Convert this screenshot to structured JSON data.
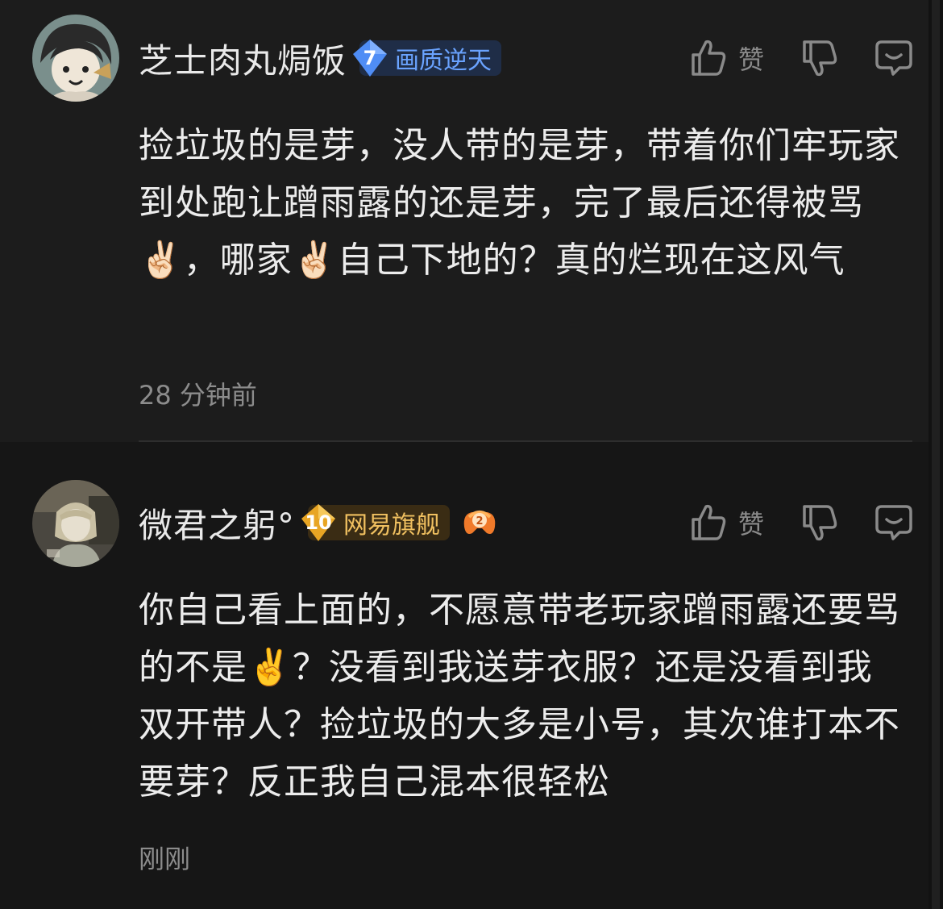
{
  "comments": [
    {
      "username": "芝士肉丸焗饭",
      "badge_level": "7",
      "badge_text": "画质逆天",
      "like_label": "赞",
      "text": "捡垃圾的是芽，没人带的是芽，带着你们牢玩家到处跑让蹭雨露的还是芽，完了最后还得被骂✌🏻，哪家✌🏻自己下地的？真的烂现在这风气",
      "time": "28 分钟前",
      "colors": {
        "badge_bg": "#1f2d47",
        "badge_text": "#6aa3ff"
      }
    },
    {
      "username": "微君之躬°",
      "badge_level": "10",
      "badge_text": "网易旗舰",
      "extra_badge_level": "2",
      "like_label": "赞",
      "text": "你自己看上面的，不愿意带老玩家蹭雨露还要骂的不是✌️？没看到我送芽衣服？还是没看到我双开带人？捡垃圾的大多是小号，其次谁打本不要芽？反正我自己混本很轻松",
      "time": "刚刚",
      "colors": {
        "badge_bg": "#3a2c14",
        "badge_text": "#f0c060"
      }
    }
  ],
  "icons": [
    "thumbs-up-icon",
    "thumbs-down-icon",
    "comment-reply-icon",
    "diamond-badge-icon",
    "controller-badge-icon"
  ]
}
